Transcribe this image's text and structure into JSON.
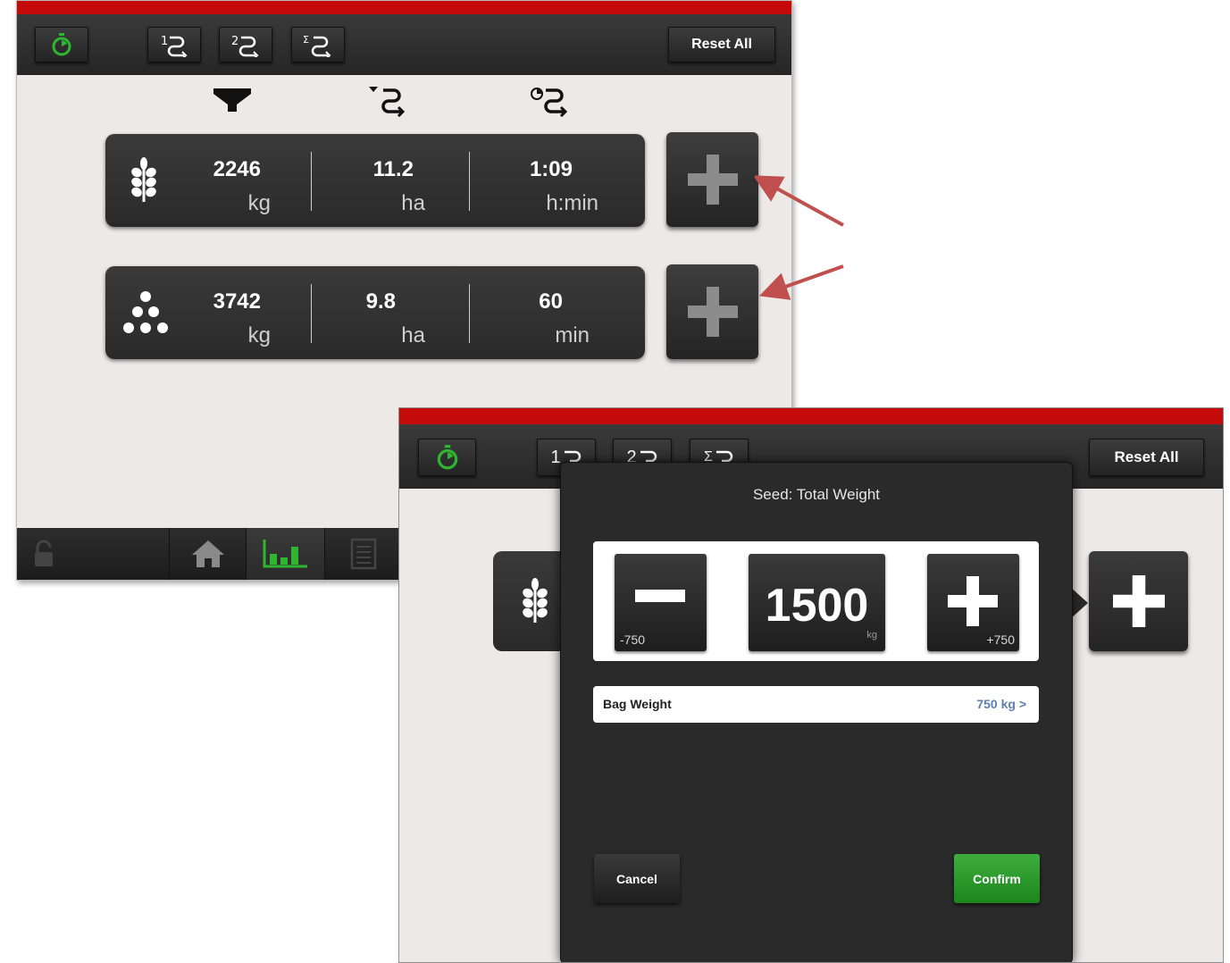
{
  "screen1": {
    "toolbar": {
      "timer_icon": "stopwatch-icon",
      "counter1_icon": "counter-1-icon",
      "counter2_icon": "counter-2-icon",
      "counter_sum_icon": "counter-sum-icon",
      "reset_label": "Reset All"
    },
    "column_icons": [
      "hopper-icon",
      "area-counter-icon",
      "time-counter-icon"
    ],
    "rows": [
      {
        "icon": "wheat-icon",
        "weight": "2246",
        "weight_unit": "kg",
        "area": "11.2",
        "area_unit": "ha",
        "time": "1:09",
        "time_unit": "h:min"
      },
      {
        "icon": "seeds-icon",
        "weight": "3742",
        "weight_unit": "kg",
        "area": "9.8",
        "area_unit": "ha",
        "time": "60",
        "time_unit": "min"
      }
    ],
    "bottom_nav": [
      "lock-icon",
      "home-icon",
      "chart-icon",
      "document-icon"
    ],
    "accent_color": "#2fb52f",
    "brand_color": "#c50a0a"
  },
  "screen2": {
    "toolbar": {
      "counter1_label": "1",
      "counter2_label": "2",
      "counter_sum_label": "Σ",
      "reset_label": "Reset All"
    },
    "dialog": {
      "title": "Seed: Total Weight",
      "value": "1500",
      "value_unit": "kg",
      "decrement_label": "-750",
      "increment_label": "+750",
      "bag_weight_label": "Bag Weight",
      "bag_weight_value": "750 kg >",
      "cancel_label": "Cancel",
      "confirm_label": "Confirm"
    }
  }
}
